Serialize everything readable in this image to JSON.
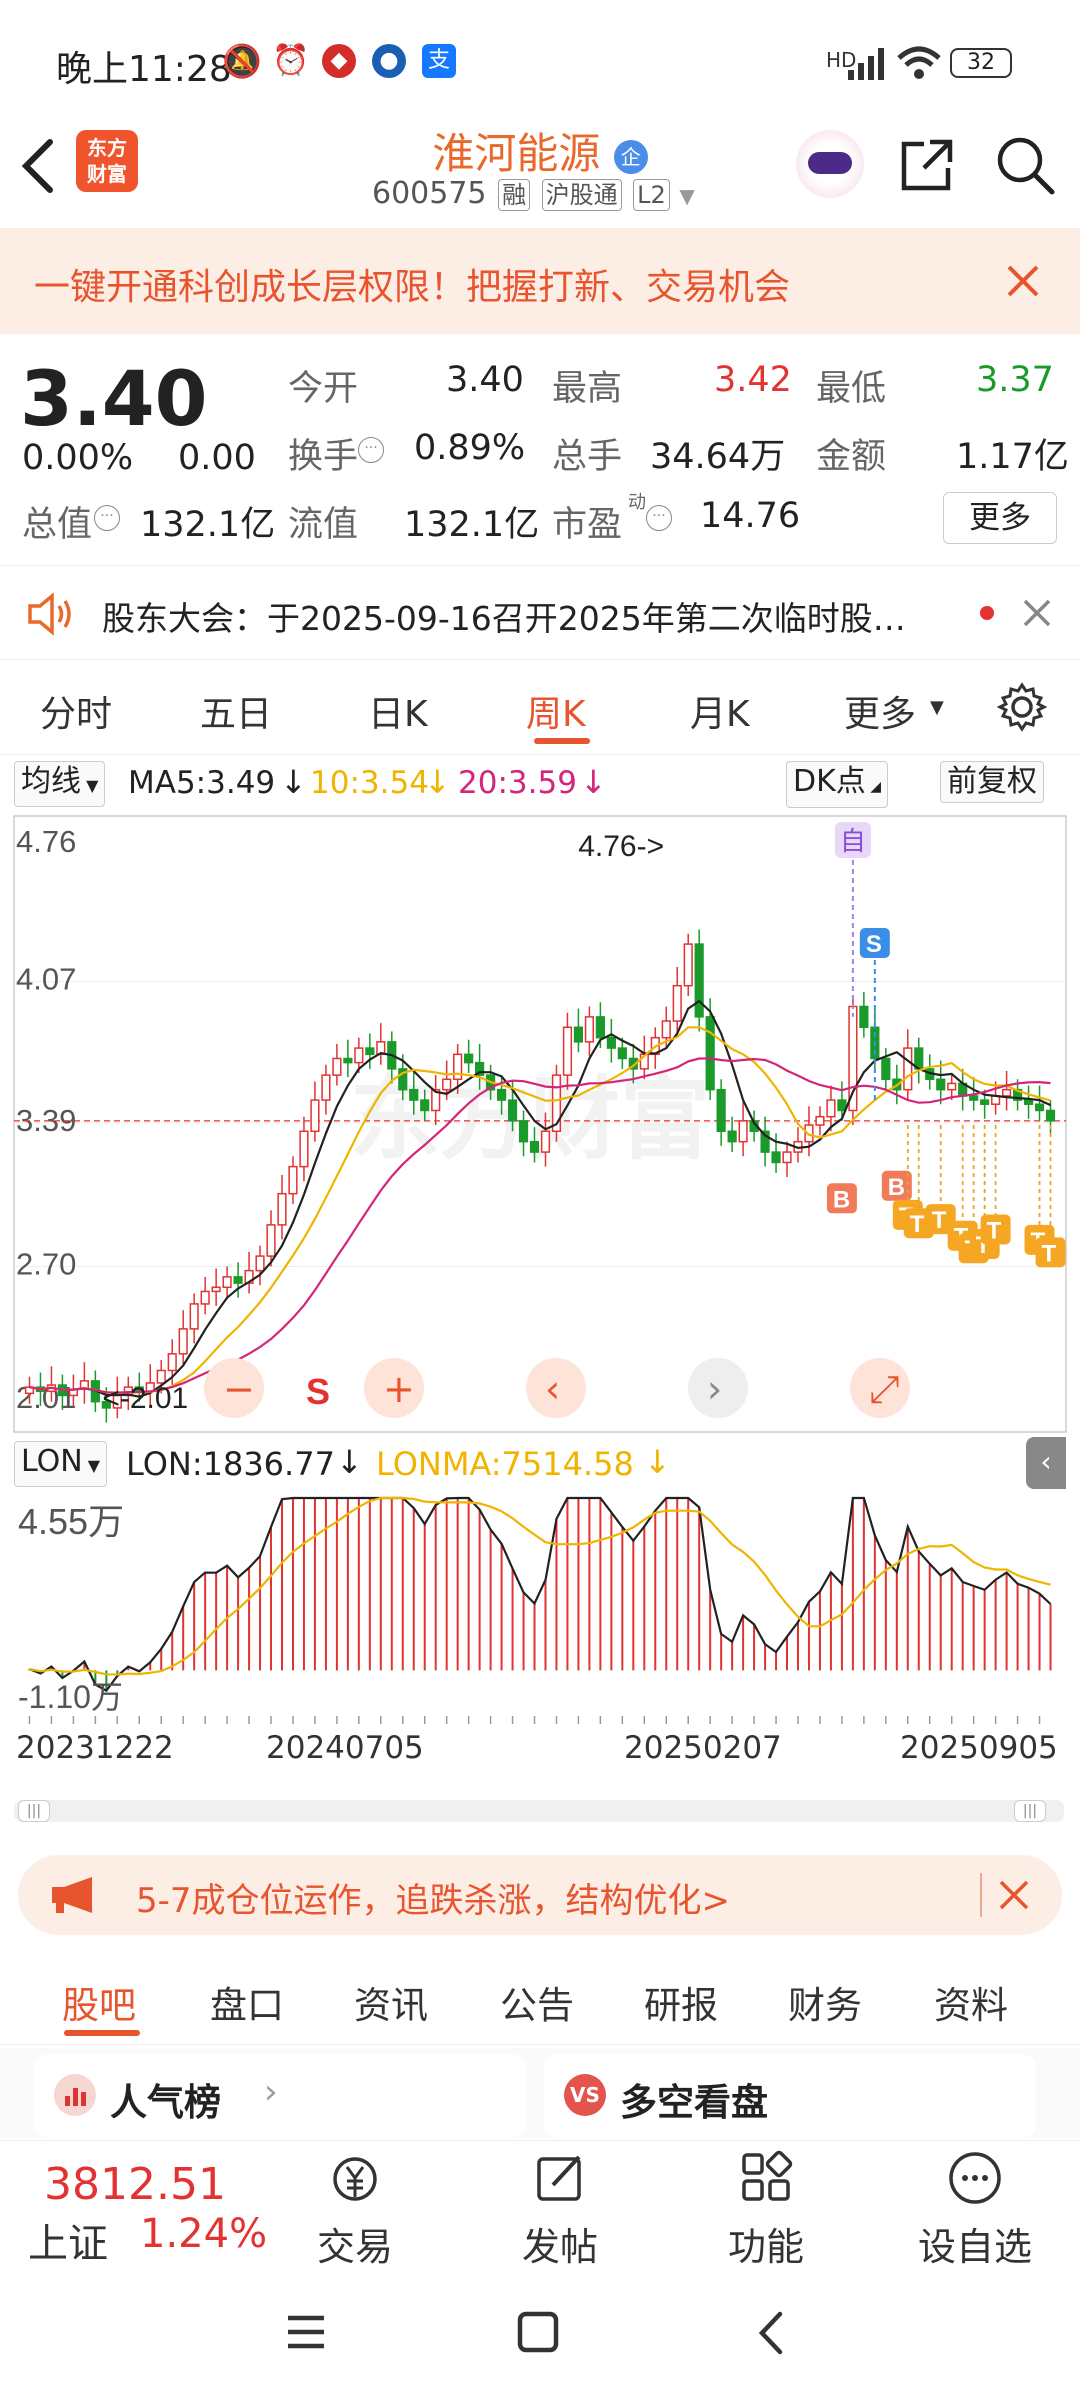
{
  "status_bar": {
    "time": "晚上11:28",
    "battery": "32",
    "network": "HD"
  },
  "header": {
    "back_icon": "chevron-left-icon",
    "app_logo": "东方\n财富",
    "stock_name": "淮河能源",
    "stock_code": "600575",
    "tags": [
      "融",
      "沪股通",
      "L2"
    ]
  },
  "banner": {
    "text": "一键开通科创成长层权限！把握打新、交易机会"
  },
  "quote": {
    "price": "3.40",
    "change_pct": "0.00%",
    "change": "0.00",
    "open_label": "今开",
    "open": "3.40",
    "high_label": "最高",
    "high": "3.42",
    "low_label": "最低",
    "low": "3.37",
    "turnover_label": "换手",
    "turnover": "0.89%",
    "volume_label": "总手",
    "volume": "34.64万",
    "amount_label": "金额",
    "amount": "1.17亿",
    "mktcap_label": "总值",
    "mktcap": "132.1亿",
    "float_label": "流值",
    "float_cap": "132.1亿",
    "pe_label": "市盈",
    "pe_sup": "动",
    "pe": "14.76",
    "more_label": "更多"
  },
  "notice": {
    "text": "股东大会：于2025-09-16召开2025年第二次临时股…"
  },
  "chart_tabs": [
    "分时",
    "五日",
    "日K",
    "周K",
    "月K",
    "更多"
  ],
  "ma_bar": {
    "mode": "均线",
    "ma5": "MA5:3.49",
    "ma10": "10:3.54",
    "ma20": "20:3.59",
    "dk": "DK点",
    "adjust": "前复权"
  },
  "kline_labels": {
    "y_ticks": [
      "4.76",
      "4.07",
      "3.39",
      "2.70",
      "2.01"
    ],
    "max_note": "4.76->",
    "min_note": "<-2.01",
    "marker_zi": "自",
    "marker_s": "S",
    "marker_b": "B",
    "marker_t": "T",
    "zoom_s": "S"
  },
  "lon_bar": {
    "mode": "LON",
    "lon": "LON:1836.77",
    "lonma": "LONMA:7514.58"
  },
  "lon_labels": {
    "top": "4.55万",
    "bottom": "-1.10万"
  },
  "dates": [
    "20231222",
    "20240705",
    "20250207",
    "20250905"
  ],
  "colors": {
    "up": "#e23232",
    "down": "#1a9a2a",
    "ma5": "#222222",
    "ma10": "#f0b400",
    "ma20": "#d4257a",
    "accent": "#e8542d"
  },
  "chart_data": [
    {
      "type": "candlestick",
      "title": "",
      "period": "weekly",
      "ylim": [
        2.01,
        4.76
      ],
      "y_ticks": [
        4.76,
        4.07,
        3.39,
        2.7,
        2.01
      ],
      "last_close": 3.4,
      "x_ticks": [
        "20231222",
        "20240705",
        "20250207",
        "20250905"
      ],
      "closes": [
        2.12,
        2.1,
        2.13,
        2.08,
        2.11,
        2.15,
        2.05,
        2.02,
        2.08,
        2.12,
        2.1,
        2.14,
        2.2,
        2.28,
        2.4,
        2.52,
        2.58,
        2.6,
        2.65,
        2.62,
        2.68,
        2.75,
        2.9,
        3.05,
        3.18,
        3.35,
        3.5,
        3.62,
        3.7,
        3.68,
        3.75,
        3.72,
        3.78,
        3.65,
        3.55,
        3.5,
        3.45,
        3.55,
        3.6,
        3.72,
        3.68,
        3.62,
        3.55,
        3.5,
        3.4,
        3.3,
        3.25,
        3.35,
        3.62,
        3.85,
        3.78,
        3.9,
        3.8,
        3.75,
        3.7,
        3.65,
        3.72,
        3.8,
        3.88,
        4.05,
        4.25,
        3.9,
        3.55,
        3.35,
        3.3,
        3.4,
        3.35,
        3.25,
        3.2,
        3.25,
        3.3,
        3.38,
        3.42,
        3.5,
        3.45,
        3.95,
        3.85,
        3.7,
        3.6,
        3.55,
        3.75,
        3.65,
        3.6,
        3.55,
        3.58,
        3.52,
        3.5,
        3.48,
        3.52,
        3.55,
        3.5,
        3.48,
        3.45,
        3.4
      ],
      "series": [
        {
          "name": "MA5",
          "value_last": 3.49
        },
        {
          "name": "10",
          "value_last": 3.54
        },
        {
          "name": "20",
          "value_last": 3.59
        }
      ]
    },
    {
      "type": "bar",
      "title": "",
      "ylim": [
        -11000,
        45500
      ],
      "series": [
        {
          "name": "LON",
          "value_last": 1836.77
        },
        {
          "name": "LONMA",
          "value_last": 7514.58
        }
      ]
    }
  ],
  "ad_bar": {
    "text": "5-7成仓位运作，追跌杀涨，结构优化>"
  },
  "info_tabs": [
    "股吧",
    "盘口",
    "资讯",
    "公告",
    "研报",
    "财务",
    "资料"
  ],
  "cards": {
    "left": "人气榜",
    "right": "多空看盘"
  },
  "index": {
    "value": "3812.51",
    "name": "上证",
    "pct": "1.24%"
  },
  "bottom_actions": [
    "交易",
    "发帖",
    "功能",
    "设自选"
  ]
}
